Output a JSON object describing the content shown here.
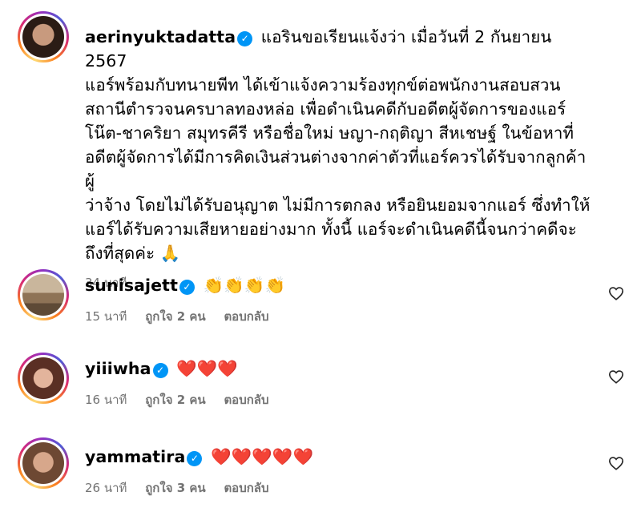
{
  "main_comment": {
    "username": "aerinyuktadatta",
    "lines": [
      "แอรินขอเรียนแจ้งว่า เมื่อวันที่ 2 กันยายน 2567",
      "แอร์พร้อมกับทนายพีท ได้เข้าแจ้งความร้องทุกข์ต่อพนักงานสอบสวน",
      "สถานีตำรวจนครบาลทองหล่อ เพื่อดำเนินคดีกับอดีตผู้จัดการของแอร์",
      "โน๊ต-ชาคริยา สมุทรคีรี หรือชื่อใหม่ ษญา-กฤติญา สีหเชษฐ์ ในข้อหาที่",
      "อดีตผู้จัดการได้มีการคิดเงินส่วนต่างจากค่าตัวที่แอร์ควรได้รับจากลูกค้าผู้",
      "ว่าจ้าง โดยไม่ได้รับอนุญาต ไม่มีการตกลง หรือยินยอมจากแอร์ ซึ่งทำให้",
      "แอร์ได้รับความเสียหายอย่างมาก ทั้งนี้ แอร์จะดำเนินคดีนี้จนกว่าคดีจะ",
      "ถึงที่สุดค่ะ"
    ],
    "time": "34 นาที",
    "emoji": "🙏"
  },
  "replies": [
    {
      "username": "sunisajett",
      "content": "👏👏👏👏",
      "time": "15 นาที",
      "likes": "ถูกใจ 2 คน",
      "reply_label": "ตอบกลับ"
    },
    {
      "username": "yiiiwha",
      "content": "❤️❤️❤️",
      "time": "16 นาที",
      "likes": "ถูกใจ 2 คน",
      "reply_label": "ตอบกลับ"
    },
    {
      "username": "yammatira",
      "content": "❤️❤️❤️❤️❤️",
      "time": "26 นาที",
      "likes": "ถูกใจ 3 คน",
      "reply_label": "ตอบกลับ"
    }
  ],
  "icons": {
    "verified": "verified-badge-icon",
    "heart": "heart-outline-icon"
  },
  "colors": {
    "verified": "#0095f6",
    "meta": "#737373",
    "heart_emoji": "#e0102b"
  }
}
